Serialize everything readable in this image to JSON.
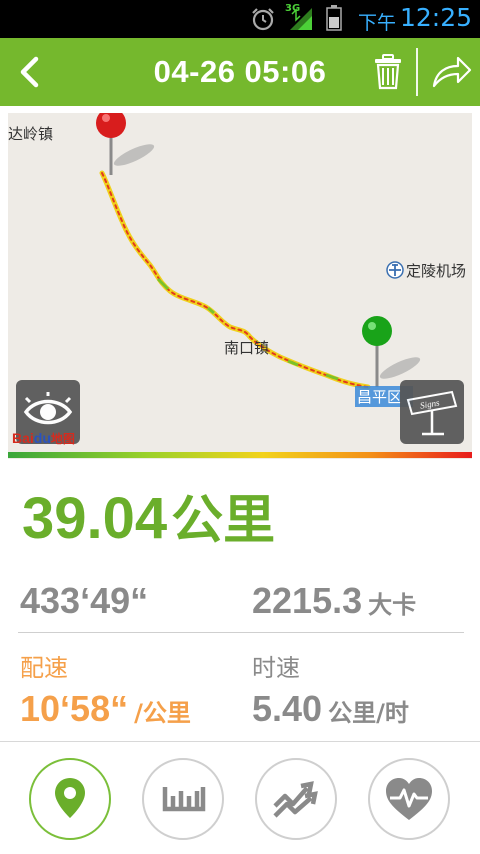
{
  "status_bar": {
    "network": "3G",
    "ampm": "下午",
    "time": "12:25",
    "icons": [
      "alarm-icon",
      "signal-icon",
      "battery-icon"
    ]
  },
  "header": {
    "title": "04-26 05:06",
    "icons": [
      "back-arrow-icon",
      "trash-icon",
      "share-icon"
    ],
    "color": "#75b82d"
  },
  "map": {
    "labels": {
      "top_left": "达岭镇",
      "airport": "定陵机场",
      "middle": "南口镇",
      "district": "昌平区"
    },
    "logo_text": "Bai",
    "logo_text2": "地图",
    "buttons": [
      "eye-icon",
      "signpost-icon"
    ],
    "signs_text": "Signs"
  },
  "stats": {
    "distance_value": "39.04",
    "distance_unit": "公里",
    "duration": "433‘49“",
    "calories_value": "2215.3",
    "calories_unit": "大卡",
    "pace_label": "配速",
    "pace_value": "10‘58“",
    "pace_unit": "/公里",
    "speed_label": "时速",
    "speed_value": "5.40",
    "speed_unit": "公里/时"
  },
  "tabs": [
    {
      "name": "tab-map",
      "icon": "location-pin-icon",
      "active": true
    },
    {
      "name": "tab-splits",
      "icon": "ruler-icon",
      "active": false
    },
    {
      "name": "tab-pace-chart",
      "icon": "trend-arrows-icon",
      "active": false
    },
    {
      "name": "tab-heart-rate",
      "icon": "heart-icon",
      "active": false
    }
  ],
  "colors": {
    "accent_green": "#6aae2b",
    "pace_orange": "#f5a04a",
    "gray_text": "#8a8a8a"
  }
}
